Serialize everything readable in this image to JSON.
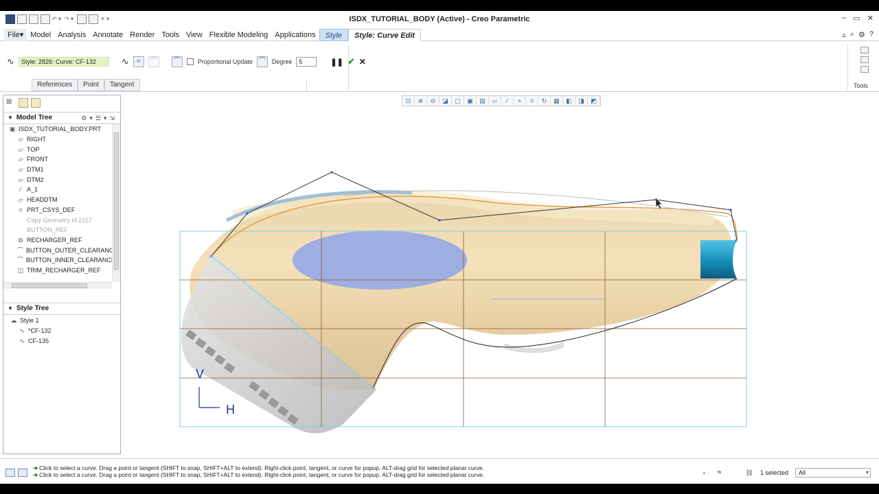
{
  "window": {
    "title": "ISDX_TUTORIAL_BODY (Active) - Creo Parametric",
    "controls": [
      "–",
      "▭",
      "✕"
    ]
  },
  "menubar": {
    "items": [
      "File",
      "Model",
      "Analysis",
      "Annotate",
      "Render",
      "Tools",
      "View",
      "Flexible Modeling",
      "Applications"
    ],
    "style_tab": "Style",
    "curve_edit_tab": "Style: Curve Edit"
  },
  "ribbon": {
    "curve_field": "Style: 2826: Curve:   CF-132",
    "proportional_update": "Proportional Update",
    "degree_label": "Degree",
    "degree_value": "5",
    "tabs": [
      "References",
      "Point",
      "Tangent"
    ],
    "tools_label": "Tools"
  },
  "model_tree": {
    "header": "Model Tree",
    "items": [
      {
        "label": "ISDX_TUTORIAL_BODY.PRT",
        "dim": false,
        "icon": "part-icon"
      },
      {
        "label": "RIGHT",
        "dim": false,
        "icon": "datum-plane-icon"
      },
      {
        "label": "TOP",
        "dim": false,
        "icon": "datum-plane-icon"
      },
      {
        "label": "FRONT",
        "dim": false,
        "icon": "datum-plane-icon"
      },
      {
        "label": "DTM1",
        "dim": false,
        "icon": "datum-plane-icon"
      },
      {
        "label": "DTM2",
        "dim": false,
        "icon": "datum-plane-icon"
      },
      {
        "label": "A_1",
        "dim": false,
        "icon": "axis-icon"
      },
      {
        "label": "HEADDTM",
        "dim": false,
        "icon": "datum-plane-icon"
      },
      {
        "label": "PRT_CSYS_DEF",
        "dim": false,
        "icon": "csys-icon"
      },
      {
        "label": "Copy Geometry id 2157",
        "dim": true,
        "icon": "copy-geometry-icon"
      },
      {
        "label": "BUTTON_REF",
        "dim": true,
        "icon": "copy-geometry-icon"
      },
      {
        "label": "RECHARGER_REF",
        "dim": false,
        "icon": "copy-geometry-icon"
      },
      {
        "label": "BUTTON_OUTER_CLEARANCE",
        "dim": false,
        "icon": "sketch-icon"
      },
      {
        "label": "BUTTON_INNER_CLEARANCE",
        "dim": false,
        "icon": "sketch-icon"
      },
      {
        "label": "TRIM_RECHARGER_REF",
        "dim": false,
        "icon": "trim-icon"
      }
    ]
  },
  "style_tree": {
    "header": "Style Tree",
    "items": [
      {
        "label": "Style 1",
        "indent": 0
      },
      {
        "label": "*CF-132",
        "indent": 1
      },
      {
        "label": "CF-135",
        "indent": 1
      }
    ]
  },
  "graphics": {
    "view_labels": {
      "v": "V",
      "h": "H"
    }
  },
  "status": {
    "messages": [
      "Click to select a curve.  Drag a point or tangent (SHIFT to snap, SHIFT+ALT to extend). Right-click point, tangent, or curve for popup. ALT-drag grid for selected planar curve.",
      "Click to select a curve.  Drag a point or tangent (SHIFT to snap, SHIFT+ALT to extend). Right-click point, tangent, or curve for popup. ALT-drag grid for selected planar curve."
    ],
    "selected": "1 selected",
    "filter": "All"
  }
}
